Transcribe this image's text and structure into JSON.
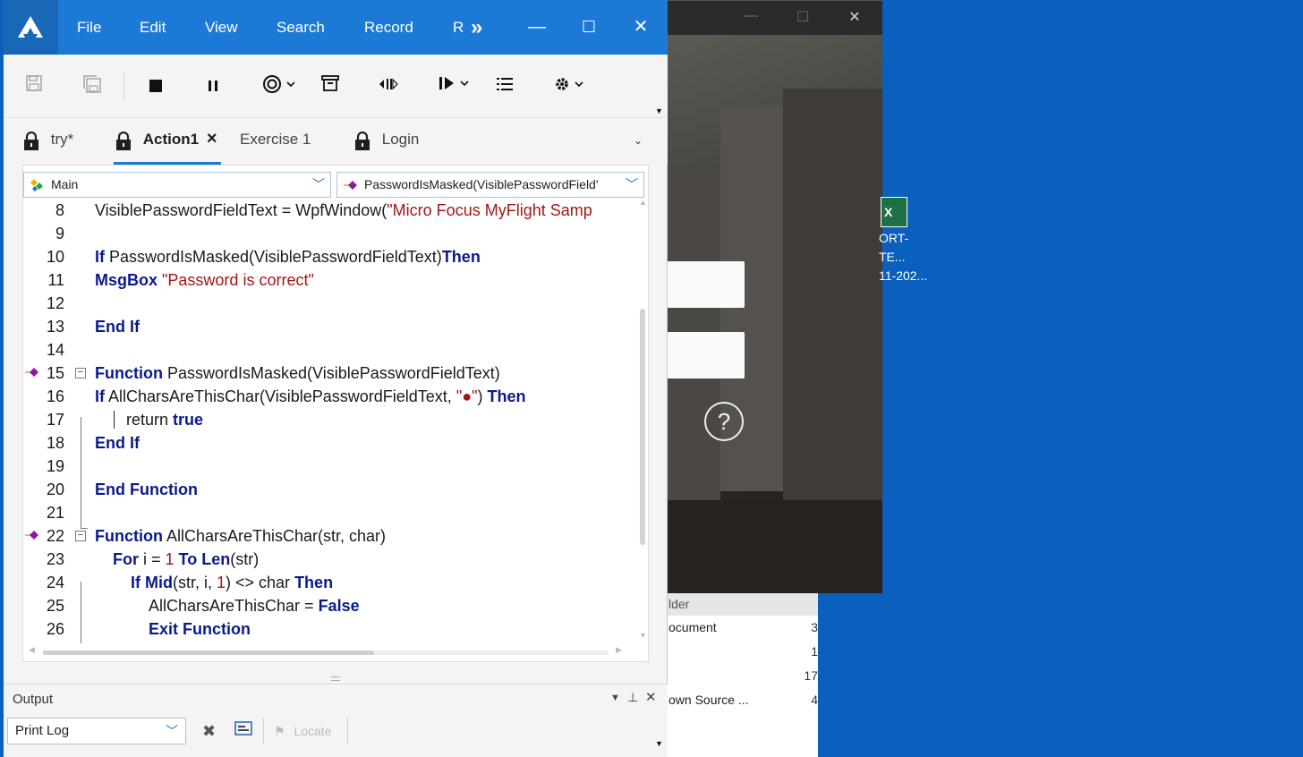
{
  "background_window": {
    "help_label": "?",
    "explorer": {
      "header": "lder",
      "rows": [
        {
          "name": "ocument",
          "value": "3"
        },
        {
          "name": "",
          "value": "1"
        },
        {
          "name": "",
          "value": "17"
        },
        {
          "name": "own Source ...",
          "value": "4"
        }
      ]
    },
    "desktop_icon": {
      "line1": "ORT-TE...",
      "line2": "11-202..."
    }
  },
  "menu": {
    "file": "File",
    "edit": "Edit",
    "view": "View",
    "search": "Search",
    "record": "Record",
    "more": "R",
    "overflow": "»"
  },
  "tabs": [
    {
      "label": "try*",
      "locked": true,
      "active": false
    },
    {
      "label": "Action1",
      "locked": true,
      "active": true,
      "close": "×"
    },
    {
      "label": "Exercise 1",
      "locked": false,
      "active": false
    },
    {
      "label": "Login",
      "locked": true,
      "active": false
    }
  ],
  "editor": {
    "scope_combo": "Main",
    "function_combo": "PasswordIsMasked(VisiblePasswordField'",
    "lines": [
      {
        "n": "8",
        "plain1": "VisiblePasswordFieldText = WpfWindow(",
        "str1": "\"Micro Focus MyFlight Samp"
      },
      {
        "n": "9"
      },
      {
        "n": "10",
        "kw1": "If",
        "plain1": " PasswordIsMasked(VisiblePasswordFieldText)",
        "kw2": "Then"
      },
      {
        "n": "11",
        "kw1": "MsgBox",
        "str1": " \"Password is correct\""
      },
      {
        "n": "12"
      },
      {
        "n": "13",
        "kw1": "End If"
      },
      {
        "n": "14"
      },
      {
        "n": "15",
        "kw1": "Function",
        "plain1": " PasswordIsMasked(VisiblePasswordFieldText)"
      },
      {
        "n": "16",
        "kw1": "If",
        "plain1": " AllCharsAreThisChar(VisiblePasswordFieldText, ",
        "str1": "\"●\"",
        "plain2": ") ",
        "kw2": "Then"
      },
      {
        "n": "17",
        "plain1": "return ",
        "kw2": "true"
      },
      {
        "n": "18",
        "kw1": "End If"
      },
      {
        "n": "19"
      },
      {
        "n": "20",
        "kw1": "End Function"
      },
      {
        "n": "21"
      },
      {
        "n": "22",
        "kw1": "Function",
        "plain1": " AllCharsAreThisChar(str, char)"
      },
      {
        "n": "23",
        "kw1": "For",
        "plain1": " i = ",
        "num1": "1",
        "plain2": " ",
        "kw2": "To Len",
        "plain3": "(str)"
      },
      {
        "n": "24",
        "kw1": "If Mid",
        "plain1": "(str, i, ",
        "num1": "1",
        "plain2": ") <> char ",
        "kw2": "Then"
      },
      {
        "n": "25",
        "plain1": "AllCharsAreThisChar = ",
        "kw2": "False"
      },
      {
        "n": "26",
        "kw1": "Exit Function"
      }
    ]
  },
  "output": {
    "title": "Output",
    "filter": "Print Log",
    "locate": "Locate"
  },
  "colors": {
    "titlebar": "#1c7ad6",
    "keyword": "#0a1a8c",
    "string": "#a31515",
    "desktop": "#0b5fbd"
  }
}
